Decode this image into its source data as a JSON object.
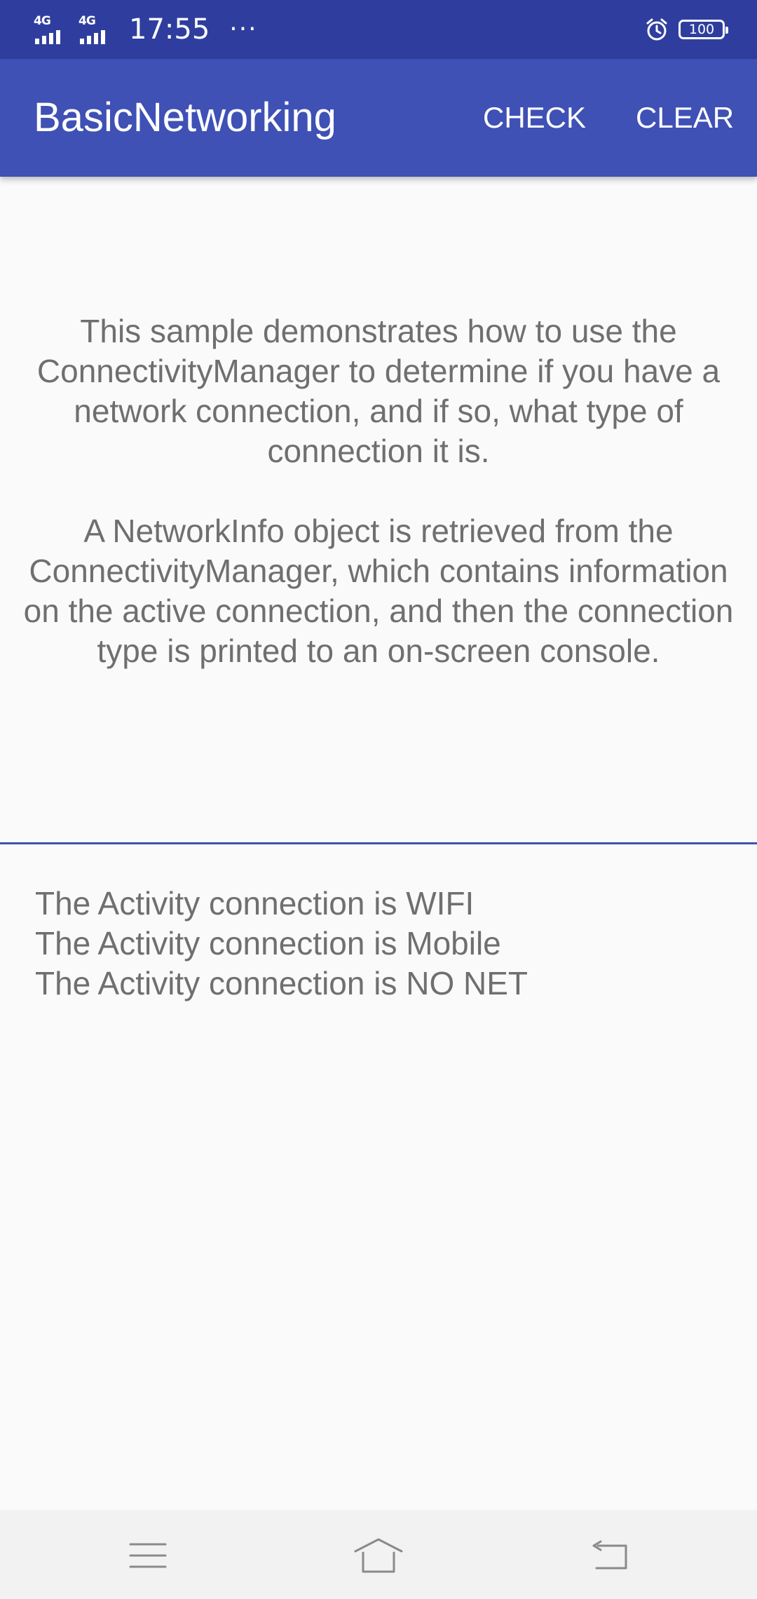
{
  "status_bar": {
    "network1": "4G",
    "network2": "4G",
    "time": "17:55",
    "more": "···",
    "battery": "100"
  },
  "app_bar": {
    "title": "BasicNetworking",
    "check_label": "CHECK",
    "clear_label": "CLEAR"
  },
  "intro": {
    "paragraph1": "This sample demonstrates how to use the ConnectivityManager to determine if you have a network connection, and if so, what type of connection it is.",
    "paragraph2": "A NetworkInfo object is retrieved from the ConnectivityManager, which contains information on the active connection, and then the connection type is printed to an on-screen console."
  },
  "console": {
    "lines": [
      "The Activity connection is WIFI",
      "The Activity connection is Mobile",
      "The Activity connection is NO NET"
    ]
  },
  "colors": {
    "status_bar": "#2f3e9e",
    "app_bar": "#3f51b5",
    "body_text": "#6f6f6f",
    "background": "#fafafa"
  }
}
